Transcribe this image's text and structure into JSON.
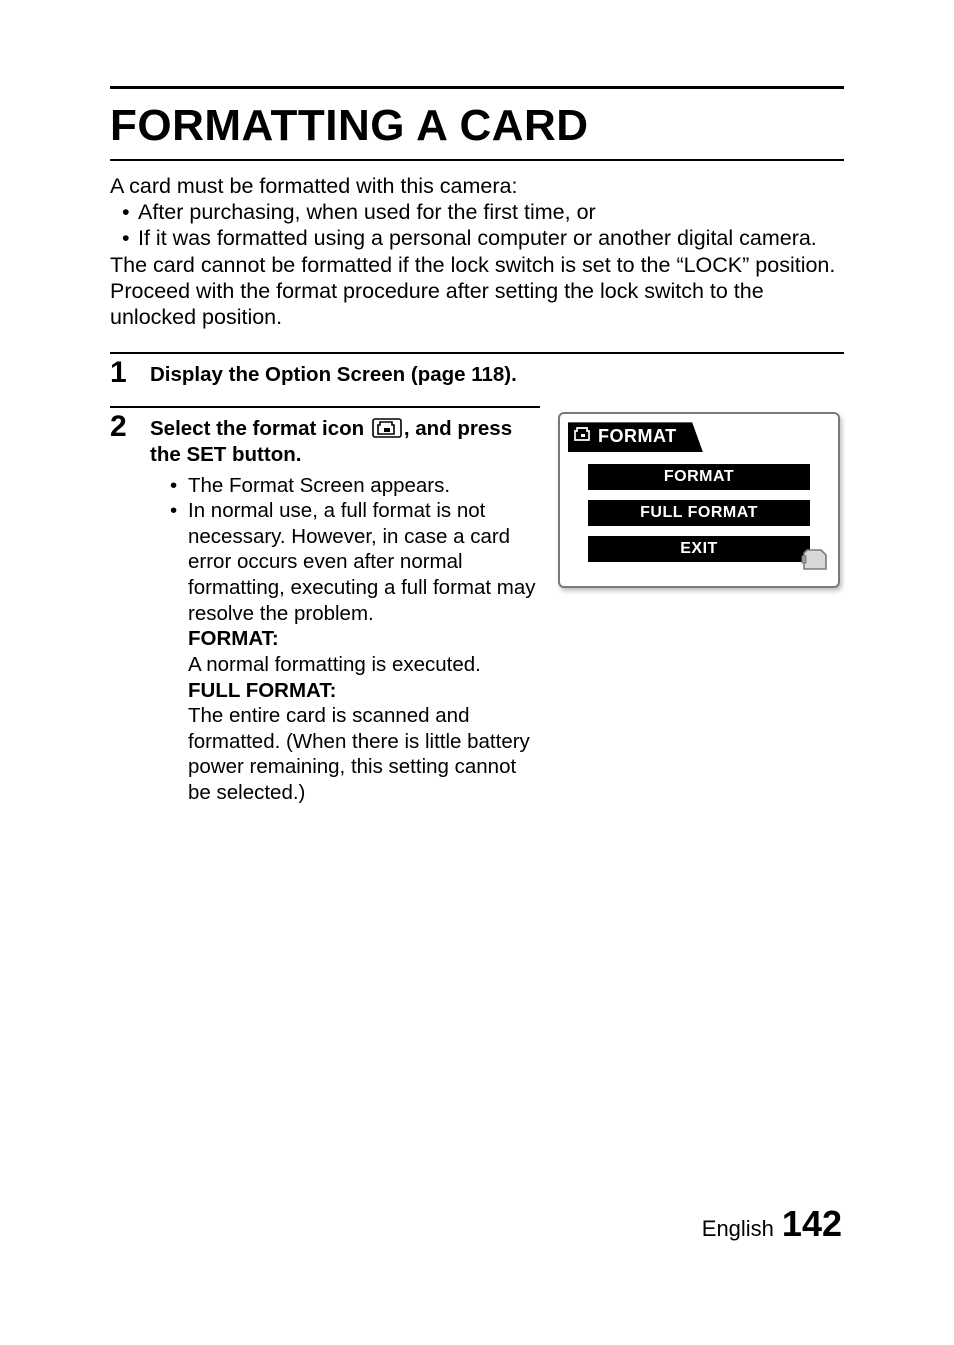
{
  "title": "FORMATTING A CARD",
  "intro": {
    "lead": "A card must be formatted with this camera:",
    "bullets": [
      "After purchasing, when used for the first time, or",
      "If it was formatted using a personal computer or another digital camera."
    ],
    "tail": "The card cannot be formatted if the lock switch is set to the “LOCK” position. Proceed with the format procedure after setting the lock switch to the unlocked position."
  },
  "step1": {
    "num": "1",
    "head": "Display the Option Screen (page 118)."
  },
  "step2": {
    "num": "2",
    "head_pre": "Select the format icon ",
    "head_post": ", and press the SET button.",
    "sub1": "The Format Screen appears.",
    "sub2": "In normal use, a full format is not necessary. However, in case a card error occurs even after normal formatting, executing a full format may resolve the problem.",
    "fmt_label": "FORMAT:",
    "fmt_text": "A normal formatting is executed.",
    "full_label": "FULL FORMAT:",
    "full_text": "The entire card is scanned and formatted. (When there is little battery power remaining, this setting cannot be selected.)"
  },
  "screen": {
    "title": "FORMAT",
    "item1": "FORMAT",
    "item2": "FULL FORMAT",
    "item3": "EXIT"
  },
  "footer": {
    "lang": "English",
    "page": "142"
  }
}
